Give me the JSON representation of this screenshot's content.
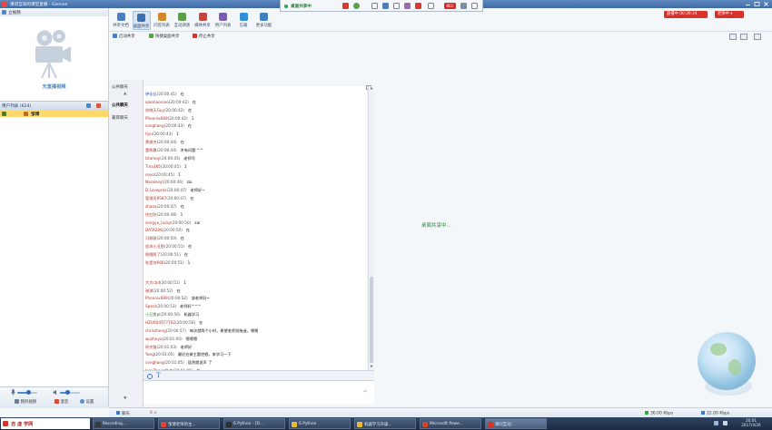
{
  "window": {
    "title": "课问互动的课堂直播 - Gensee"
  },
  "share_bar": {
    "status": "桌面共享中",
    "record_label": "REC"
  },
  "toolbar": {
    "tools": [
      {
        "label": "共享文档",
        "icon": "document-icon",
        "color": "#4a7fc1"
      },
      {
        "label": "桌面共享",
        "icon": "desktop-share-icon",
        "color": "#3a6fb5",
        "active": true
      },
      {
        "label": "问答列表",
        "icon": "qa-icon",
        "color": "#d5862a"
      },
      {
        "label": "互动调查",
        "icon": "survey-icon",
        "color": "#5a9e47"
      },
      {
        "label": "媒体共享",
        "icon": "media-share-icon",
        "color": "#c6443a"
      },
      {
        "label": "用户列表",
        "icon": "users-icon",
        "color": "#7a5db3"
      },
      {
        "label": "信箱",
        "icon": "mail-icon",
        "color": "#2f8fd8"
      },
      {
        "label": "更多功能",
        "icon": "more-icon",
        "color": "#3f7fc0"
      }
    ],
    "live_badge": "直播中 00:39:24",
    "teacher_badge": "老师中 ▾"
  },
  "sub_toolbar": {
    "start_share": "启动共享",
    "quick_share": "快捷桌面共享",
    "stop_share": "停止共享"
  },
  "left_panel": {
    "header": "立视频",
    "no_video": "无直播视频",
    "users_header": "用户列表 (624)",
    "users": [
      {
        "name": "邹博"
      }
    ],
    "bottom": {
      "my_video": "我的视频",
      "mute": "混音",
      "settings": "设置",
      "mic_level": 0.55,
      "speaker_level": 0.4
    }
  },
  "chat": {
    "tabs": [
      "公共聊天",
      "公共聊天",
      "嘉宾聊天"
    ],
    "selected_tab": 1,
    "messages": [
      {
        "name": "钟佳佳",
        "time": "(20:00:41)",
        "text": "在",
        "color": "b"
      },
      {
        "name": "qiaohaonaio",
        "time": "(20:00:42)",
        "text": "在",
        "color": "r"
      },
      {
        "name": "徐晓天Guy",
        "time": "(20:00:42)",
        "text": "在",
        "color": "r"
      },
      {
        "name": "Phoenix689",
        "time": "(20:00:42)",
        "text": "1",
        "color": "r"
      },
      {
        "name": "conghang",
        "time": "(20:00:43)",
        "text": "在",
        "color": "r"
      },
      {
        "name": "tiyu",
        "time": "(20:00:43)",
        "text": "1",
        "color": "r"
      },
      {
        "name": "黄俊杰",
        "time": "(20:00:44)",
        "text": "在",
        "color": "r"
      },
      {
        "name": "董辉晨",
        "time": "(20:00:44)",
        "text": "木有问题 ^^",
        "color": "r"
      },
      {
        "name": "Izlamay",
        "time": "(20:00:45)",
        "text": "老师号",
        "color": "r"
      },
      {
        "name": "Tina385",
        "time": "(20:00:45)",
        "text": "1",
        "color": "r"
      },
      {
        "name": "ceyo",
        "time": "(20:00:45)",
        "text": "1",
        "color": "r"
      },
      {
        "name": "Naralesyl",
        "time": "(20:00:46)",
        "text": "zai",
        "color": "r"
      },
      {
        "name": "D Lovepros",
        "time": "(20:00:47)",
        "text": "老师好~",
        "color": "r"
      },
      {
        "name": "管理员9587",
        "time": "(20:00:47)",
        "text": "在",
        "color": "r"
      },
      {
        "name": "zhaoa",
        "time": "(20:00:47)",
        "text": "在",
        "color": "r"
      },
      {
        "name": "徐红秋",
        "time": "(20:00:48)",
        "text": "1",
        "color": "r"
      },
      {
        "name": "zengyu_lucky",
        "time": "(20:00:50)",
        "text": "zai",
        "color": "r"
      },
      {
        "name": "DATA206",
        "time": "(20:00:50)",
        "text": "在",
        "color": "r"
      },
      {
        "name": "冯群群",
        "time": "(20:00:50)",
        "text": "在",
        "color": "r"
      },
      {
        "name": "追求小丑鱼",
        "time": "(20:00:51)",
        "text": "在",
        "color": "r"
      },
      {
        "name": "帆眼眶了",
        "time": "(20:00:51)",
        "text": "在",
        "color": "r"
      },
      {
        "name": "秋是何666",
        "time": "(20:00:51)",
        "text": "1",
        "color": "r"
      },
      {
        "name": "",
        "time": "",
        "text": "",
        "color": "r"
      },
      {
        "name": "大大cbd",
        "time": "(20:00:51)",
        "text": "1",
        "color": "r"
      },
      {
        "name": "谢琪",
        "time": "(20:00:52)",
        "text": "在",
        "color": "r"
      },
      {
        "name": "Phoenix689",
        "time": "(20:00:52)",
        "text": "邹老师好~",
        "color": "r"
      },
      {
        "name": "Spero",
        "time": "(20:00:53)",
        "text": "老师好^^^",
        "color": "r"
      },
      {
        "name": "小丑鱼pl",
        "time": "(20:00:56)",
        "text": "机器学习",
        "color": "g"
      },
      {
        "name": "HZU604977702",
        "time": "(20:00:56)",
        "text": "在",
        "color": "r"
      },
      {
        "name": "chriszheng",
        "time": "(20:00:57)",
        "text": "每次就两个小时，希望老师别拖迷，嘿嘿",
        "color": "r"
      },
      {
        "name": "wuzhoyo",
        "time": "(20:01:00)",
        "text": "嗯嗯嗯",
        "color": "r"
      },
      {
        "name": "阿杰猫",
        "time": "(20:01:03)",
        "text": "老师好",
        "color": "r"
      },
      {
        "name": "Yang",
        "time": "(20:01:05)",
        "text": "最近在做主题挖掘，来学习一下",
        "color": "r"
      },
      {
        "name": "conghang",
        "time": "(20:01:05)",
        "text": "居然就说声 了",
        "color": "r"
      },
      {
        "name": "JackZhang陈杰",
        "time": "(20:01:05)",
        "text": "在",
        "color": "r"
      }
    ],
    "bottom_tab": "聊天",
    "bottom_status": "0 ×"
  },
  "main": {
    "share_message": "桌面共享中..."
  },
  "status": {
    "upload": "36.00 Kbps",
    "download": "22.00 Kbps"
  },
  "taskbar": {
    "start_label": "自 虚 学网",
    "items": [
      {
        "label": "Recording...",
        "color": "#3a3a3a"
      },
      {
        "label": "邹博老师的主...",
        "color": "#db4437"
      },
      {
        "label": "6.Python - [D...",
        "color": "#2f2f2f"
      },
      {
        "label": "6.Python",
        "color": "#e8b93a"
      },
      {
        "label": "机器学习升级...",
        "color": "#e8b93a"
      },
      {
        "label": "Microsoft Powe...",
        "color": "#d2472c"
      },
      {
        "label": "课问互动...",
        "color": "#d8342a",
        "active": true
      }
    ],
    "clock_time": "20:01",
    "clock_date": "2017/4/26"
  }
}
